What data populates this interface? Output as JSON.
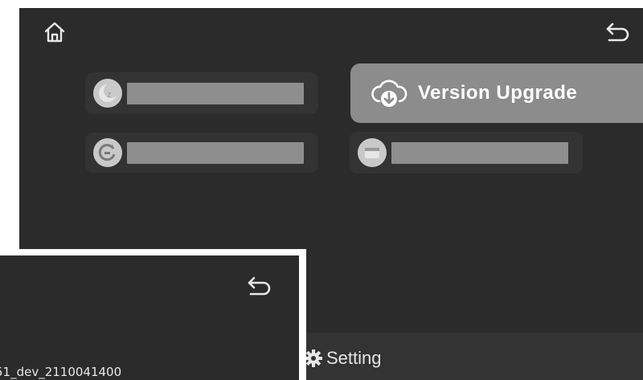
{
  "main_screen": {
    "home_icon": "home-icon",
    "back_icon": "back-arrow-icon",
    "menu": {
      "item1_icon": "z-sleep-icon",
      "item2_icon": "refresh-icon",
      "version_upgrade": {
        "label": "Version Upgrade",
        "icon": "cloud-download-icon"
      },
      "item4_icon": "window-icon"
    },
    "bottom_tab": {
      "label": "Setting",
      "icon": "gear-icon"
    }
  },
  "overlay_screen": {
    "back_icon": "back-arrow-icon",
    "version_text": "51_dev_2110041400"
  },
  "colors": {
    "screen_bg": "#2b2b2b",
    "item_bg": "#333333",
    "highlight": "#8c8c8c",
    "text": "#ffffff"
  }
}
